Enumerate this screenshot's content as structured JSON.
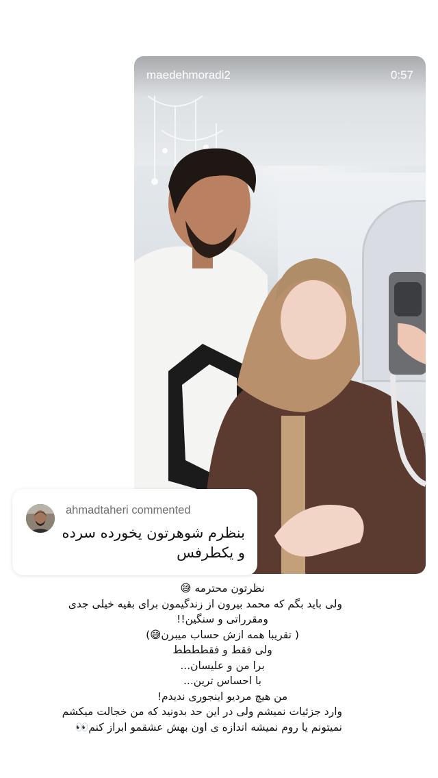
{
  "post": {
    "username": "maedehmoradi2",
    "duration": "0:57"
  },
  "comment": {
    "username": "ahmadtaheri",
    "action": "commented",
    "text": "بنظرم شوهرتون یخورده سرده و یکطرفس"
  },
  "reply": {
    "lines": [
      "نظرتون محترمه 😅",
      "ولی باید بگم که محمد بیرون از زندگیمون برای بقیه خیلی جدی",
      "ومقرراتی و سنگین!!",
      "( تقریبا همه  ازش حساب میبرن😅)",
      "ولی فقط و فقطططط",
      "برا من و علیسان...",
      "با احساس ترین...",
      "من هیچ مردیو اینجوری ندیدم!",
      "وارد جزئیات نمیشم ولی در این حد بدونید که من خجالت میکشم",
      "نمیتونم یا روم نمیشه اندازه ی اون بهش عشقمو ابراز کنم👀"
    ]
  }
}
